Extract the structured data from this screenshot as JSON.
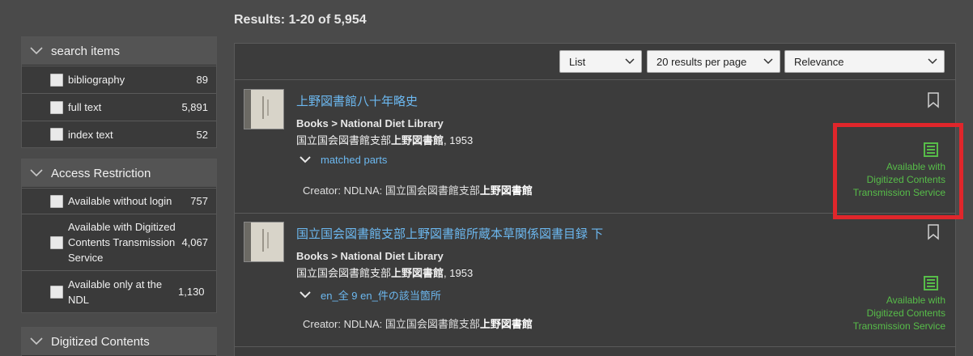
{
  "results_heading": "Results: 1-20 of 5,954",
  "sidebar": {
    "facets": [
      {
        "title": "search items",
        "rows": [
          {
            "label": "bibliography",
            "count": "89"
          },
          {
            "label": "full text",
            "count": "5,891"
          },
          {
            "label": "index text",
            "count": "52"
          }
        ]
      },
      {
        "title": "Access Restriction",
        "rows": [
          {
            "label": "Available without login",
            "count": "757"
          },
          {
            "label": "Available with Digitized Contents Transmission Service",
            "count": "4,067"
          },
          {
            "label": "Available only at the NDL",
            "count": "1,130"
          }
        ]
      },
      {
        "title": "Digitized Contents",
        "rows": []
      }
    ]
  },
  "toolbar": {
    "view_select": "List",
    "per_page_select": "20 results per page",
    "sort_select": "Relevance"
  },
  "results": [
    {
      "title": "上野図書館八十年略史",
      "type": "Books > National Diet Library",
      "publisher_prefix": "国立国会図書館支部",
      "publisher_bold": "上野図書館",
      "year": ", 1953",
      "matched": "matched parts",
      "creator_prefix": "Creator: NDLNA: 国立国会図書館支部",
      "creator_bold": "上野図書館",
      "availability": [
        "Available with",
        "Digitized Contents",
        "Transmission Service"
      ]
    },
    {
      "title": "国立国会図書館支部上野図書館所蔵本草関係図書目録 下",
      "type": "Books > National Diet Library",
      "publisher_prefix": "国立国会図書館支部",
      "publisher_bold": "上野図書館",
      "year": ", 1953",
      "matched": "en_全 9 en_件の該当箇所",
      "creator_prefix": "Creator: NDLNA: 国立国会図書館支部",
      "creator_bold": "上野図書館",
      "availability": [
        "Available with",
        "Digitized Contents",
        "Transmission Service"
      ]
    }
  ],
  "colors": {
    "link": "#6cb8f0",
    "availability_green": "#57bd49",
    "highlight_red": "#e0262b"
  }
}
